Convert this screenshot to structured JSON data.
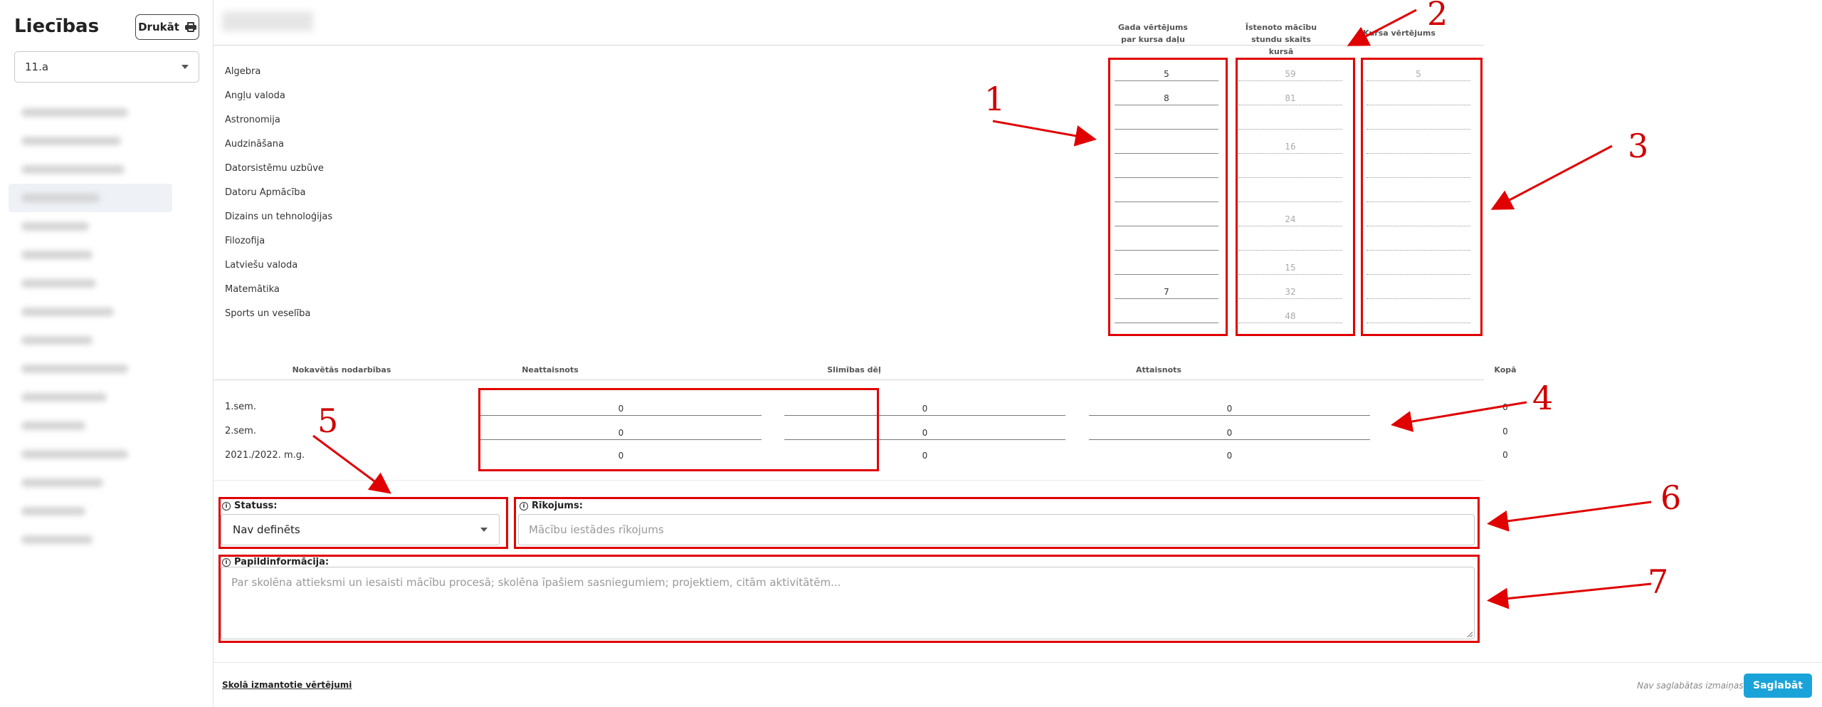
{
  "sidebar": {
    "title": "Liecības",
    "print_label": "Drukāt",
    "class_value": "11.a"
  },
  "grades": {
    "col_year_grade": "Gada vērtējums par kursa daļu",
    "col_hours": "Īstenoto mācību stundu skaits kursā",
    "col_course_grade": "Kursa vērtējums",
    "subjects": [
      {
        "name": "Algebra",
        "year_grade": "5",
        "hours": "59",
        "course_grade": "5"
      },
      {
        "name": "Angļu valoda",
        "year_grade": "8",
        "hours": "81",
        "course_grade": ""
      },
      {
        "name": "Astronomija",
        "year_grade": "",
        "hours": "",
        "course_grade": ""
      },
      {
        "name": "Audzināšana",
        "year_grade": "",
        "hours": "16",
        "course_grade": ""
      },
      {
        "name": "Datorsistēmu uzbūve",
        "year_grade": "",
        "hours": "",
        "course_grade": ""
      },
      {
        "name": "Datoru Apmācība",
        "year_grade": "",
        "hours": "",
        "course_grade": ""
      },
      {
        "name": "Dizains un tehnoloģijas",
        "year_grade": "",
        "hours": "24",
        "course_grade": ""
      },
      {
        "name": "Filozofija",
        "year_grade": "",
        "hours": "",
        "course_grade": ""
      },
      {
        "name": "Latviešu valoda",
        "year_grade": "",
        "hours": "15",
        "course_grade": ""
      },
      {
        "name": "Matemātika",
        "year_grade": "7",
        "hours": "32",
        "course_grade": ""
      },
      {
        "name": "Sports un veselība",
        "year_grade": "",
        "hours": "48",
        "course_grade": ""
      }
    ]
  },
  "absences": {
    "headers": [
      "Nokavētās nodarbības",
      "Neattaisnots",
      "Slimības dēļ",
      "Attaisnots",
      "Kopā"
    ],
    "rows": [
      {
        "label": "1.sem.",
        "unexcused": "0",
        "sick": "0",
        "excused": "0",
        "total": "0"
      },
      {
        "label": "2.sem.",
        "unexcused": "0",
        "sick": "0",
        "excused": "0",
        "total": "0"
      },
      {
        "label": "2021./2022. m.g.",
        "unexcused": "0",
        "sick": "0",
        "excused": "0",
        "total": "0"
      }
    ]
  },
  "form": {
    "status_label": "Statuss:",
    "status_value": "Nav definēts",
    "order_label": "Rīkojums:",
    "order_placeholder": "Mācību iestādes rīkojums",
    "extra_label": "Papildinformācija:",
    "extra_placeholder": "Par skolēna attieksmi un iesaisti mācību procesā; skolēna īpašiem sasniegumiem; projektiem, citām aktivitātēm..."
  },
  "footer": {
    "grades_link": "Skolā izmantotie vērtējumi",
    "unsaved_text": "Nav saglabātas izmaiņas",
    "save_label": "Saglabāt"
  },
  "annotations": [
    "1",
    "2",
    "3",
    "4",
    "5",
    "6",
    "7"
  ],
  "colors": {
    "annotation": "#e00000",
    "save_button": "#1aa3d9"
  }
}
